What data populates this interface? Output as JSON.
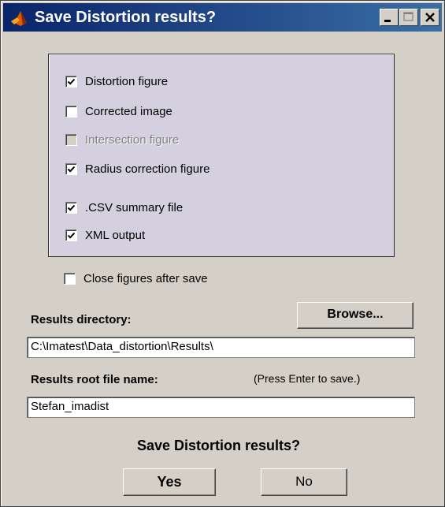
{
  "window": {
    "title": "Save Distortion results?"
  },
  "options": [
    {
      "label": "Distortion figure",
      "checked": true,
      "enabled": true
    },
    {
      "label": "Corrected image",
      "checked": false,
      "enabled": true
    },
    {
      "label": "Intersection figure",
      "checked": false,
      "enabled": false
    },
    {
      "label": "Radius correction figure",
      "checked": true,
      "enabled": true
    },
    {
      "label": ".CSV summary file",
      "checked": true,
      "enabled": true
    },
    {
      "label": "XML output",
      "checked": true,
      "enabled": true
    }
  ],
  "close_figures": {
    "label": "Close figures after save",
    "checked": false
  },
  "results_directory": {
    "label": "Results directory:",
    "value": "C:\\Imatest\\Data_distortion\\Results\\",
    "browse_label": "Browse..."
  },
  "results_root": {
    "label": "Results root file name:",
    "hint": "(Press Enter to save.)",
    "value": "Stefan_imadist"
  },
  "prompt": {
    "question": "Save Distortion results?",
    "yes_label": "Yes",
    "no_label": "No"
  }
}
